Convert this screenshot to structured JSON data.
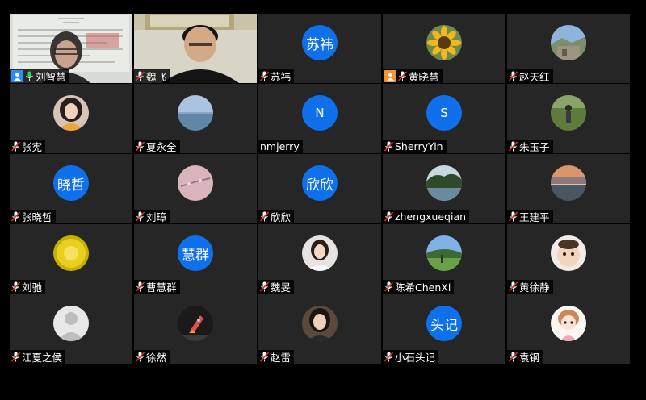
{
  "participants": [
    {
      "name": "刘智慧",
      "avatar_text": "",
      "kind": "video-doc"
    },
    {
      "name": "魏飞",
      "avatar_text": "",
      "kind": "video-man"
    },
    {
      "name": "苏祎",
      "avatar_text": "苏祎",
      "kind": "text"
    },
    {
      "name": "黄晓慧",
      "avatar_text": "",
      "kind": "photo",
      "photo": "sunflower"
    },
    {
      "name": "赵天红",
      "avatar_text": "",
      "kind": "photo",
      "photo": "landscape"
    },
    {
      "name": "张宪",
      "avatar_text": "",
      "kind": "photo",
      "photo": "woman-portrait"
    },
    {
      "name": "夏永全",
      "avatar_text": "",
      "kind": "photo",
      "photo": "sea"
    },
    {
      "name": "nmjerry",
      "avatar_text": "N",
      "kind": "text"
    },
    {
      "name": "SherryYin",
      "avatar_text": "S",
      "kind": "text"
    },
    {
      "name": "朱玉子",
      "avatar_text": "",
      "kind": "photo",
      "photo": "person-grass"
    },
    {
      "name": "张晓哲",
      "avatar_text": "晓哲",
      "kind": "text"
    },
    {
      "name": "刘璋",
      "avatar_text": "",
      "kind": "photo",
      "photo": "pink-branch"
    },
    {
      "name": "欣欣",
      "avatar_text": "欣欣",
      "kind": "text"
    },
    {
      "name": "zhengxueqian",
      "avatar_text": "",
      "kind": "photo",
      "photo": "lake-trees"
    },
    {
      "name": "王建平",
      "avatar_text": "",
      "kind": "photo",
      "photo": "sunset-city"
    },
    {
      "name": "刘驰",
      "avatar_text": "",
      "kind": "photo",
      "photo": "yellow-flower"
    },
    {
      "name": "曹慧群",
      "avatar_text": "慧群",
      "kind": "text"
    },
    {
      "name": "魏旻",
      "avatar_text": "",
      "kind": "photo",
      "photo": "woman-white"
    },
    {
      "name": "陈希ChenXi",
      "avatar_text": "",
      "kind": "photo",
      "photo": "campus"
    },
    {
      "name": "黄徐静",
      "avatar_text": "",
      "kind": "photo",
      "photo": "baby"
    },
    {
      "name": "江夏之侯",
      "avatar_text": "",
      "kind": "photo",
      "photo": "default-user"
    },
    {
      "name": "徐然",
      "avatar_text": "",
      "kind": "photo",
      "photo": "rocket"
    },
    {
      "name": "赵雷",
      "avatar_text": "",
      "kind": "photo",
      "photo": "woman-dark"
    },
    {
      "name": "小石头记",
      "avatar_text": "头记",
      "kind": "text"
    },
    {
      "name": "袁钢",
      "avatar_text": "",
      "kind": "photo",
      "photo": "cartoon-girl"
    }
  ],
  "colors": {
    "accent": "#0e71eb",
    "active_speaker": "#23d959",
    "host_badge": "#f7942d",
    "tile_bg": "#262626"
  }
}
